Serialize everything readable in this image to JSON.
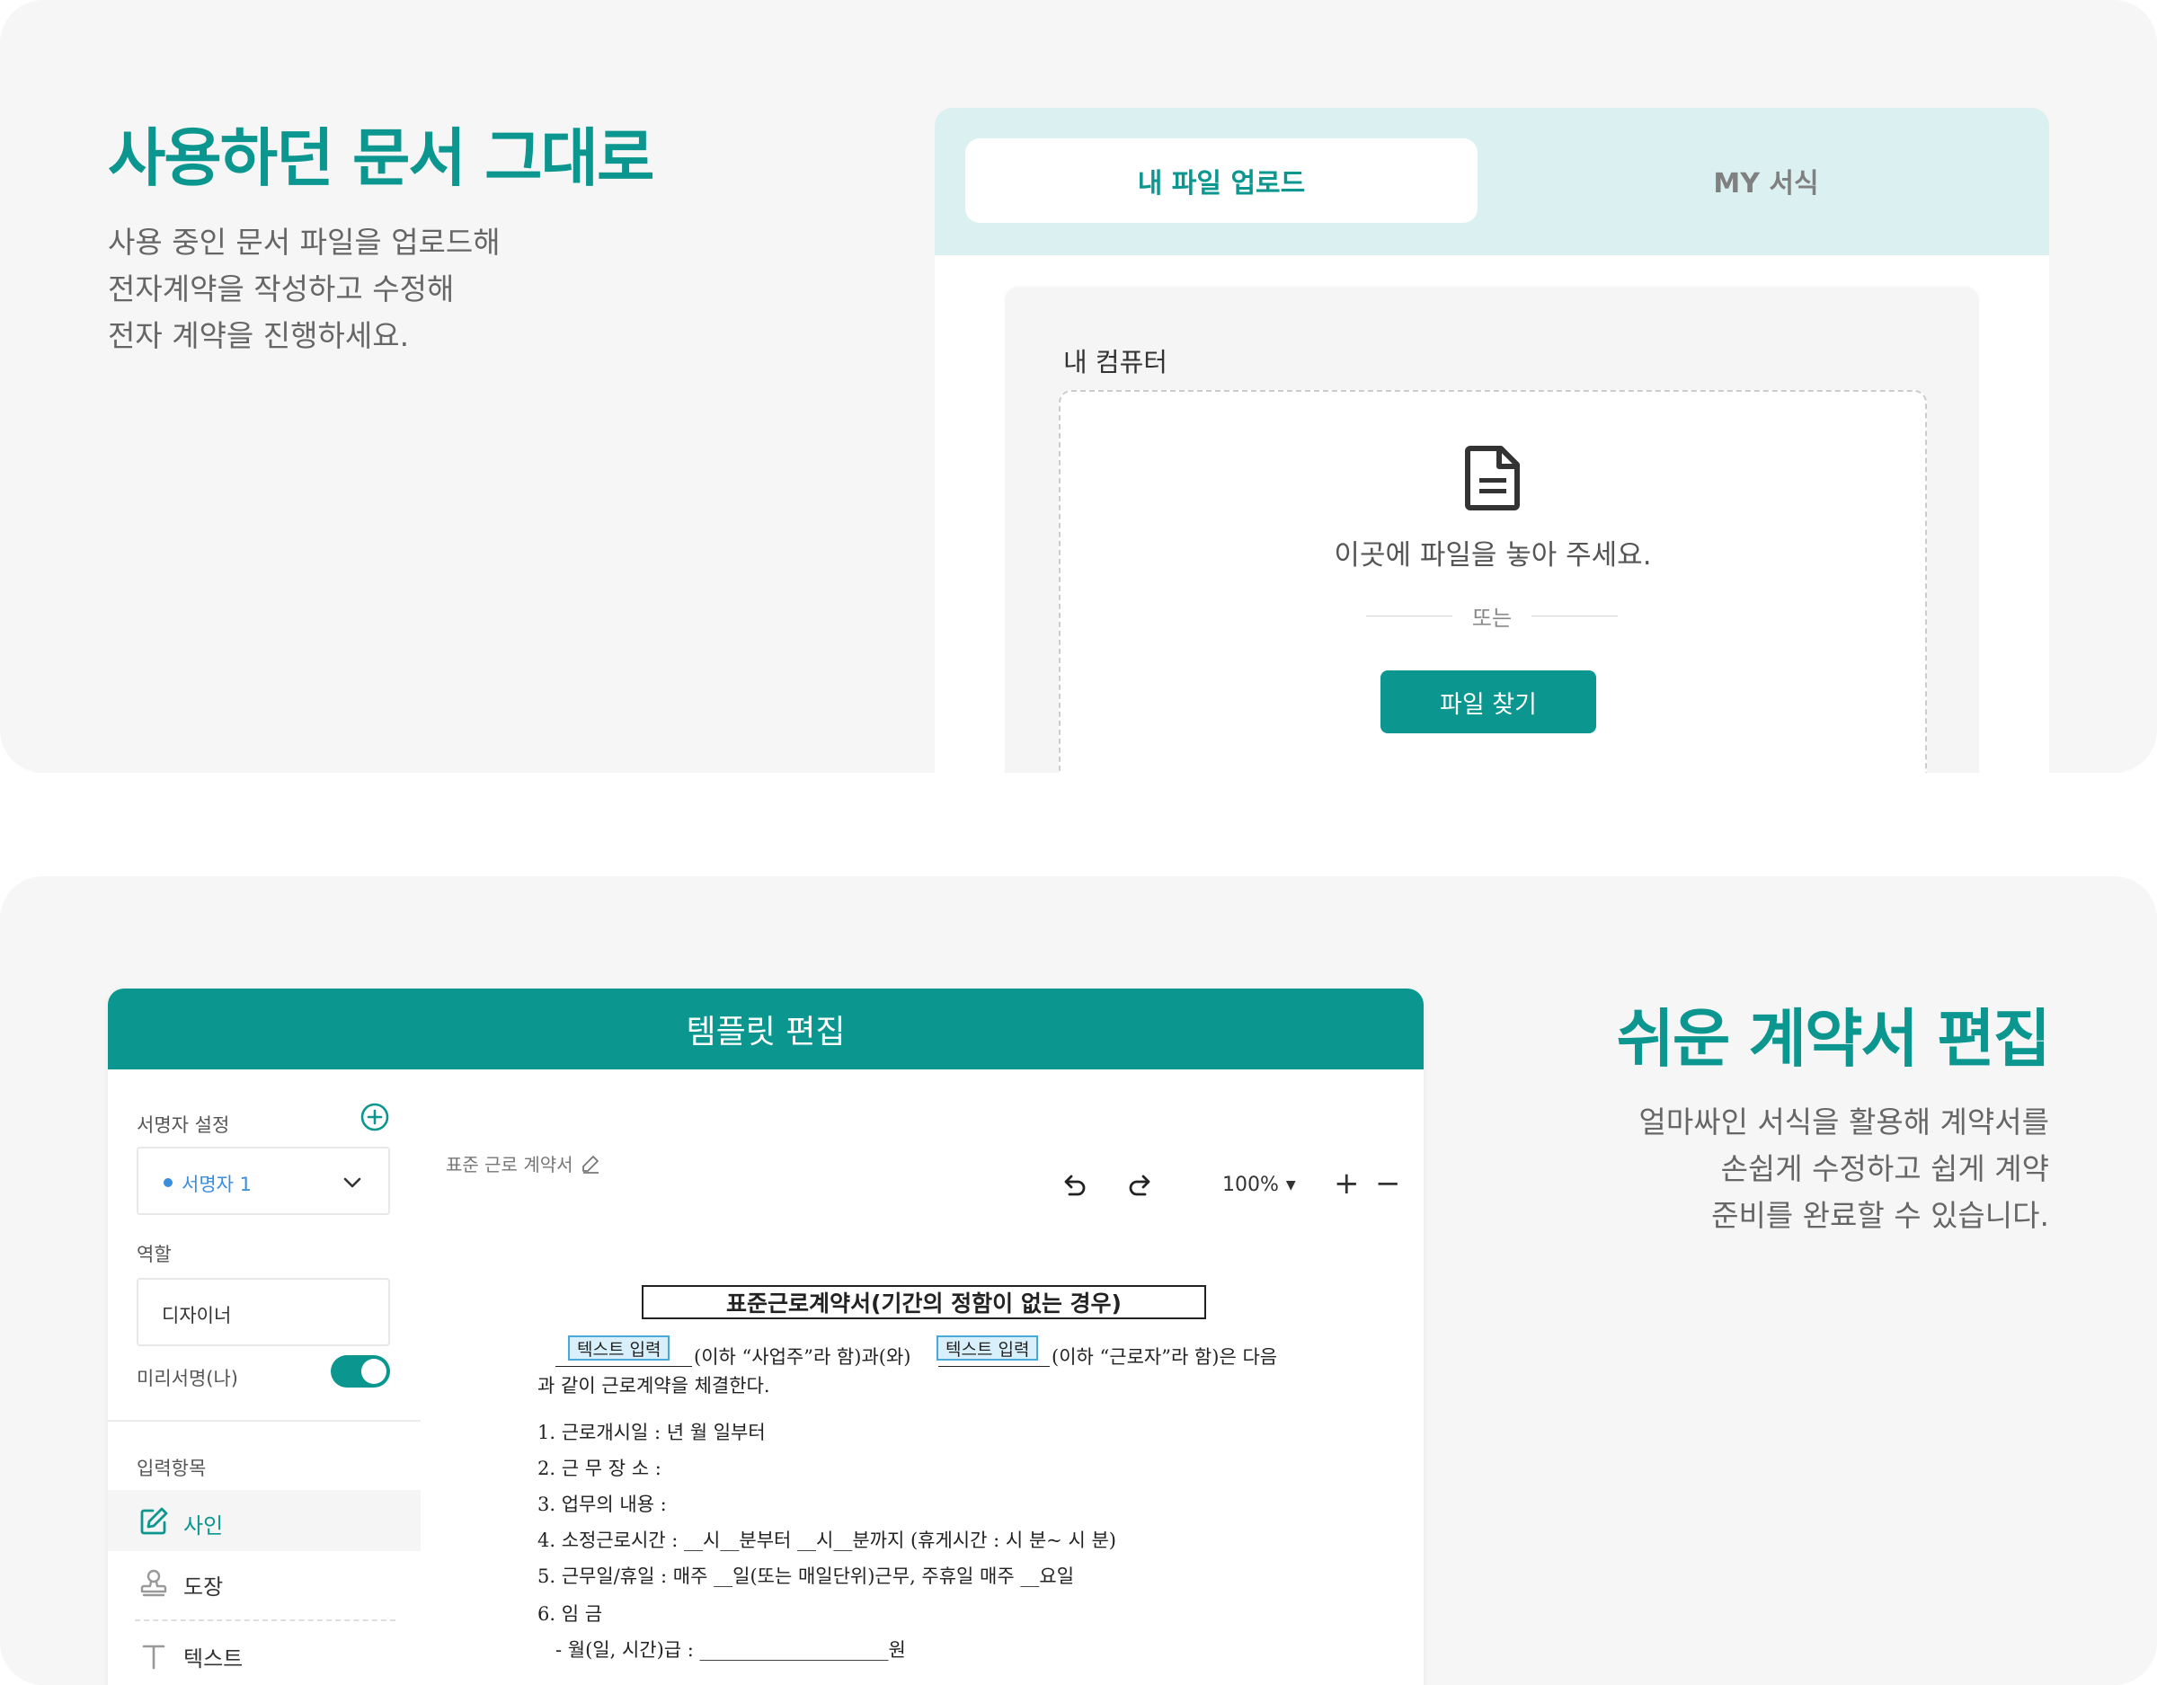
{
  "colors": {
    "accent": "#0b978f",
    "tab_bar_bg": "#dbf0f0",
    "card_bg": "#f6f6f6",
    "signer_blue": "#3a8edb",
    "field_tag_bg": "#d8f0fb"
  },
  "section1": {
    "title": "사용하던 문서 그대로",
    "desc_lines": [
      "사용 중인 문서 파일을 업로드해",
      "전자계약을 작성하고 수정해",
      "전자 계약을 진행하세요."
    ],
    "tabs": {
      "upload": "내 파일 업로드",
      "my_forms": "MY 서식"
    },
    "computer_label": "내 컴퓨터",
    "drop_text": "이곳에 파일을 놓아 주세요.",
    "or_text": "또는",
    "find_button": "파일 찾기",
    "icons": {
      "file": "file-document-icon"
    }
  },
  "section2": {
    "title": "쉬운 계약서 편집",
    "desc_lines": [
      "얼마싸인 서식을 활용해 계약서를",
      "손쉽게 수정하고 쉽게 계약",
      "준비를 완료할 수 있습니다."
    ],
    "editor": {
      "header": "템플릿 편집",
      "sidebar": {
        "signer_label": "서명자 설정",
        "signer_value": "서명자 1",
        "role_label": "역할",
        "role_value": "디자이너",
        "preview_label": "미리서명(나)",
        "preview_on": true,
        "input_label": "입력항목",
        "items": [
          {
            "label": "사인",
            "icon": "edit-sign-icon",
            "selected": true
          },
          {
            "label": "도장",
            "icon": "stamp-icon",
            "selected": false
          },
          {
            "label": "텍스트",
            "icon": "text-icon",
            "selected": false
          }
        ]
      },
      "doc_name": "표준 근로 계약서",
      "zoom": "100%",
      "zoom_in": "+",
      "zoom_out": "−",
      "document": {
        "title": "표준근로계약서(기간의 정함이 없는 경우)",
        "field_tag": "텍스트 입력",
        "intro_part1": "(이하 “사업주”라 함)과(와)",
        "intro_part2": "(이하 “근로자”라 함)은 다음",
        "intro_line2": "과 같이 근로계약을 체결한다.",
        "lines": [
          "1. 근로개시일 :       년    월    일부터",
          "2. 근 무 장 소 :",
          "3. 업무의 내용 :",
          "4. 소정근로시간 : __시__분부터 __시__분까지 (휴게시간 : 시 분~ 시 분)",
          "5. 근무일/휴일 : 매주 __일(또는 매일단위)근무, 주휴일 매주 __요일",
          "6. 임    금",
          "- 월(일, 시간)급 : ____________________원"
        ]
      }
    }
  }
}
